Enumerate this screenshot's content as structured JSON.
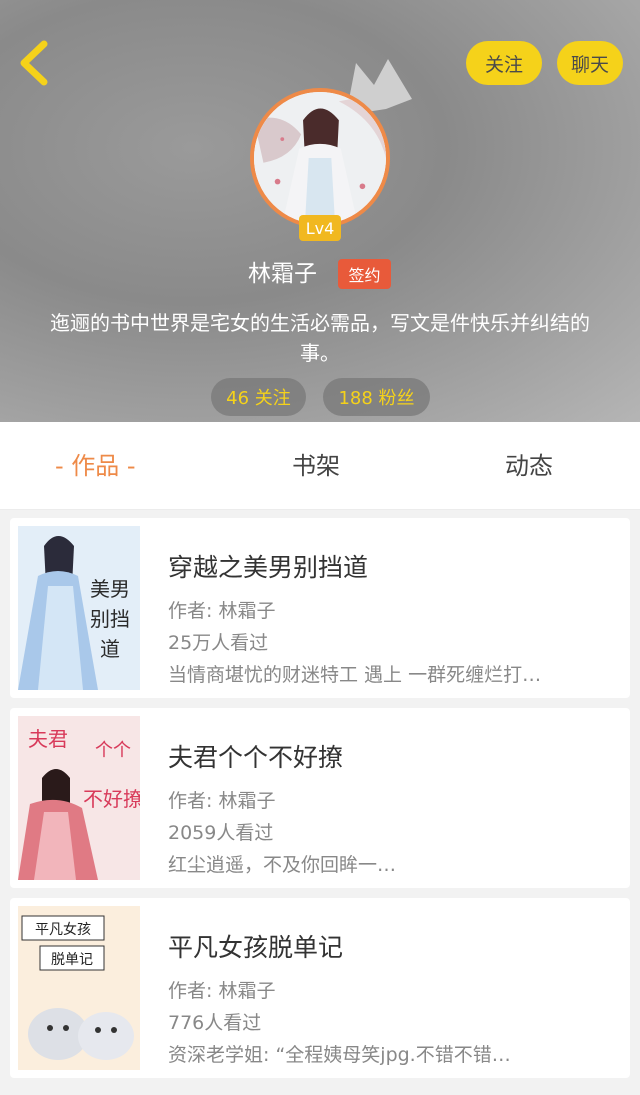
{
  "header": {
    "follow_label": "关注",
    "chat_label": "聊天",
    "level": "Lv4",
    "name": "林霜子",
    "badge": "签约",
    "bio": "迤逦的书中世界是宅女的生活必需品，写文是件快乐并纠结的事。",
    "following": "46 关注",
    "fans": "188 粉丝"
  },
  "tabs": [
    {
      "label": "- 作品 -",
      "active": true
    },
    {
      "label": "书架",
      "active": false
    },
    {
      "label": "动态",
      "active": false
    }
  ],
  "books": [
    {
      "title": "穿越之美男别挡道",
      "author": "作者: 林霜子",
      "views": "25万人看过",
      "desc": "当情商堪忧的财迷特工 遇上 一群死缠烂打…",
      "cover_text": [
        "美男",
        "别挡",
        "道"
      ]
    },
    {
      "title": "夫君个个不好撩",
      "author": "作者: 林霜子",
      "views": "2059人看过",
      "desc": "红尘逍遥，不及你回眸一…",
      "cover_text": [
        "夫君",
        "个个",
        "不好撩"
      ]
    },
    {
      "title": "平凡女孩脱单记",
      "author": "作者: 林霜子",
      "views": "776人看过",
      "desc": "资深老学姐: “全程姨母笑jpg.不错不错…",
      "cover_text": [
        "平凡女孩",
        "脱单记"
      ]
    }
  ],
  "colors": {
    "accent": "#ee8a48",
    "yellow": "#f5d21a",
    "badge_red": "#e85a3a"
  }
}
